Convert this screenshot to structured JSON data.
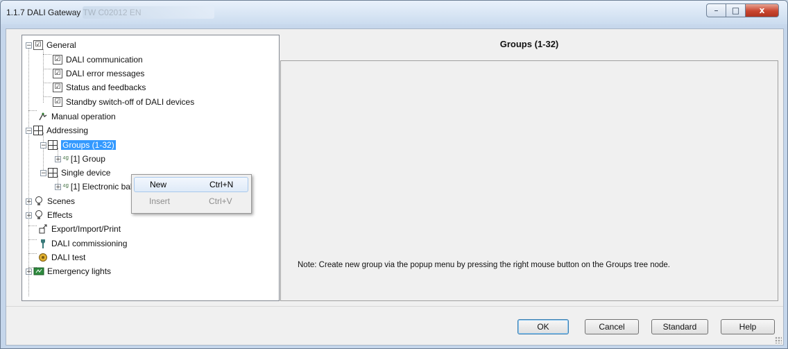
{
  "window": {
    "title": "1.1.7 DALI Gateway TW C02012 EN"
  },
  "tree": {
    "nodes": [
      {
        "label": "General",
        "expander": "−"
      },
      {
        "label": "DALI communication"
      },
      {
        "label": "DALI error messages"
      },
      {
        "label": "Status and feedbacks"
      },
      {
        "label": "Standby switch-off of DALI devices"
      },
      {
        "label": "Manual operation"
      },
      {
        "label": "Addressing",
        "expander": "−"
      },
      {
        "label": "Groups (1-32)",
        "expander": "−"
      },
      {
        "label": "[1] Group",
        "expander": "+"
      },
      {
        "label": "Single device",
        "expander": "−"
      },
      {
        "label": "[1] Electronic ballast",
        "expander": "+"
      },
      {
        "label": "Scenes",
        "expander": "+"
      },
      {
        "label": "Effects",
        "expander": "+"
      },
      {
        "label": "Export/Import/Print"
      },
      {
        "label": "DALI commissioning"
      },
      {
        "label": "DALI test"
      },
      {
        "label": "Emergency lights",
        "expander": "+"
      }
    ],
    "icons": {
      "check": "☑",
      "grid": "grid-icon",
      "manual": "manual-operation-icon",
      "bulb": "bulb-icon",
      "export": "export-icon",
      "commission": "commissioning-icon",
      "test": "test-icon",
      "emergency": "emergency-light-icon"
    },
    "obj_glyph": "⁴ᵍ"
  },
  "context_menu": {
    "items": [
      {
        "label": "New",
        "shortcut": "Ctrl+N",
        "enabled": true
      },
      {
        "label": "Insert",
        "shortcut": "Ctrl+V",
        "enabled": false
      }
    ]
  },
  "panel": {
    "title": "Groups (1-32)",
    "note": "Note: Create new group via the popup menu by pressing the right  mouse button on the Groups tree node."
  },
  "buttons": {
    "ok": "OK",
    "cancel": "Cancel",
    "standard": "Standard",
    "help": "Help"
  },
  "window_controls": {
    "minimize": "–",
    "maximize": "□",
    "close": "x"
  },
  "colors": {
    "selection": "#3399ff",
    "close_button": "#c9452f"
  }
}
